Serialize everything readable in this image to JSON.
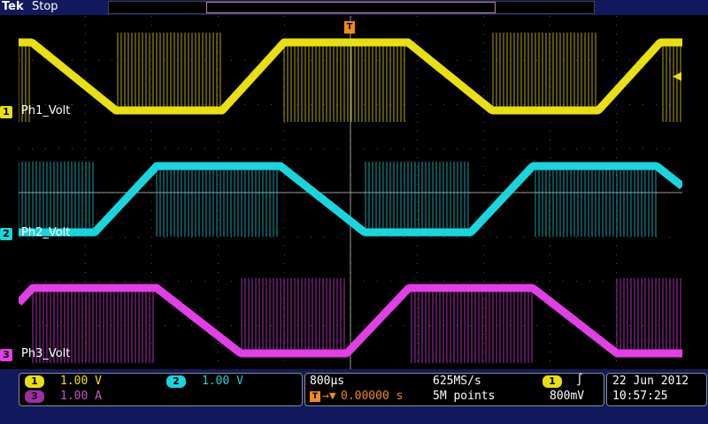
{
  "header": {
    "brand": "Tek",
    "status": "Stop"
  },
  "trigger": {
    "marker": "T",
    "level_arrow": "◀"
  },
  "channels": [
    {
      "num": "1",
      "label": "Ph1_Volt",
      "color": "#e8e010"
    },
    {
      "num": "2",
      "label": "Ph2_Volt",
      "color": "#19d6dc"
    },
    {
      "num": "3",
      "label": "Ph3_Volt",
      "color": "#e23fe6"
    }
  ],
  "readout": {
    "ch1": {
      "num": "1",
      "value": "1.00 V"
    },
    "ch2": {
      "num": "2",
      "value": "1.00 V"
    },
    "ch3": {
      "num": "3",
      "value": "1.00 A"
    },
    "timebase": "800µs",
    "sample_rate": "625MS/s",
    "delay": "0.00000 s",
    "record_length": "5M points",
    "trig_channel": "1",
    "trig_slope": "∫",
    "trig_level": "800mV",
    "date": "22 Jun  2012",
    "time": "10:57:25"
  }
}
